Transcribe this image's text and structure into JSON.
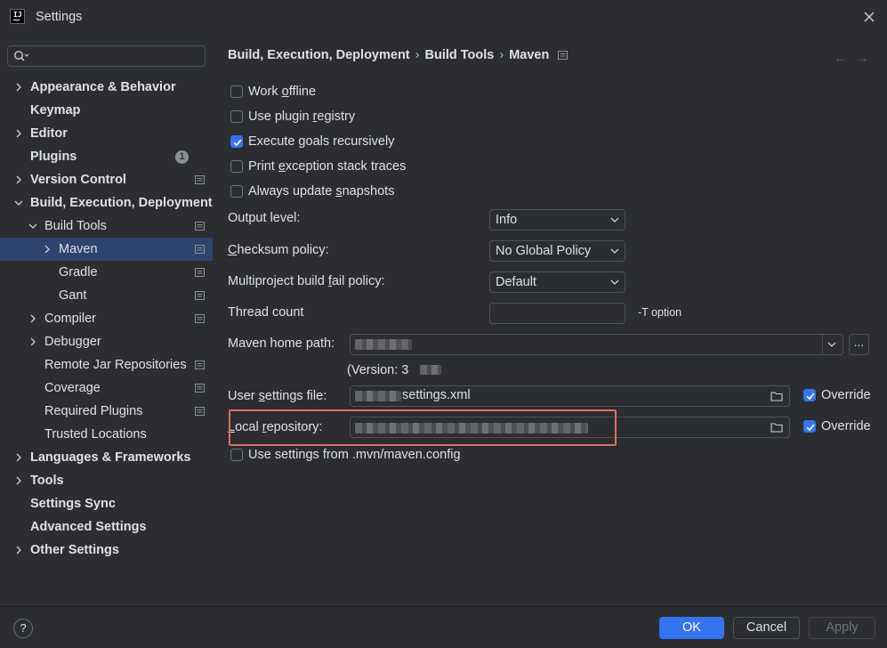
{
  "window": {
    "title": "Settings",
    "app_icon_text": "IJ"
  },
  "search": {
    "placeholder": "",
    "value": ""
  },
  "sidebar": {
    "items": [
      {
        "label": "Appearance & Behavior",
        "expandable": true,
        "expanded": false,
        "bold": true,
        "badge": "",
        "module": false
      },
      {
        "label": "Keymap",
        "expandable": false,
        "bold": true,
        "badge": "",
        "module": false
      },
      {
        "label": "Editor",
        "expandable": true,
        "expanded": false,
        "bold": true,
        "badge": "",
        "module": false
      },
      {
        "label": "Plugins",
        "expandable": false,
        "bold": true,
        "badge": "1",
        "module": false
      },
      {
        "label": "Version Control",
        "expandable": true,
        "expanded": false,
        "bold": true,
        "badge": "",
        "module": true
      },
      {
        "label": "Build, Execution, Deployment",
        "expandable": true,
        "expanded": true,
        "bold": true,
        "badge": "",
        "module": false
      },
      {
        "label": "Build Tools",
        "expandable": true,
        "expanded": true,
        "bold": false,
        "badge": "",
        "module": true
      },
      {
        "label": "Maven",
        "expandable": true,
        "expanded": false,
        "bold": false,
        "badge": "",
        "module": true,
        "selected": true
      },
      {
        "label": "Gradle",
        "expandable": false,
        "bold": false,
        "badge": "",
        "module": true
      },
      {
        "label": "Gant",
        "expandable": false,
        "bold": false,
        "badge": "",
        "module": true
      },
      {
        "label": "Compiler",
        "expandable": true,
        "expanded": false,
        "bold": false,
        "badge": "",
        "module": true
      },
      {
        "label": "Debugger",
        "expandable": true,
        "expanded": false,
        "bold": false,
        "badge": "",
        "module": false
      },
      {
        "label": "Remote Jar Repositories",
        "expandable": false,
        "bold": false,
        "badge": "",
        "module": true
      },
      {
        "label": "Coverage",
        "expandable": false,
        "bold": false,
        "badge": "",
        "module": true
      },
      {
        "label": "Required Plugins",
        "expandable": false,
        "bold": false,
        "badge": "",
        "module": true
      },
      {
        "label": "Trusted Locations",
        "expandable": false,
        "bold": false,
        "badge": "",
        "module": false
      },
      {
        "label": "Languages & Frameworks",
        "expandable": true,
        "expanded": false,
        "bold": true,
        "badge": "",
        "module": false
      },
      {
        "label": "Tools",
        "expandable": true,
        "expanded": false,
        "bold": true,
        "badge": "",
        "module": false
      },
      {
        "label": "Settings Sync",
        "expandable": false,
        "bold": true,
        "badge": "",
        "module": false
      },
      {
        "label": "Advanced Settings",
        "expandable": false,
        "bold": true,
        "badge": "",
        "module": false
      },
      {
        "label": "Other Settings",
        "expandable": true,
        "expanded": false,
        "bold": true,
        "badge": "",
        "module": false
      }
    ]
  },
  "breadcrumb": {
    "items": [
      "Build, Execution, Deployment",
      "Build Tools",
      "Maven"
    ],
    "separator": "›"
  },
  "checkboxes": {
    "work_offline": {
      "pre": "Work ",
      "ul": "o",
      "post": "ffline",
      "checked": false
    },
    "plugin_registry": {
      "pre": "Use plugin ",
      "ul": "r",
      "post": "egistry",
      "checked": false
    },
    "recursive": {
      "pre": "Execute ",
      "ul": "g",
      "post": "oals recursively",
      "checked": true
    },
    "stack_traces": {
      "pre": "Print ",
      "ul": "e",
      "post": "xception stack traces",
      "checked": false
    },
    "snapshots": {
      "pre": "Always update ",
      "ul": "s",
      "post": "napshots",
      "checked": false
    },
    "mvn_config": {
      "pre": "Use settings from .mvn/maven.config",
      "ul": "",
      "post": "",
      "checked": false
    }
  },
  "fields": {
    "output_level": {
      "label": "Output level:",
      "value": "Info"
    },
    "checksum_policy": {
      "label_ul": "C",
      "label_rest": "hecksum policy:",
      "value": "No Global Policy"
    },
    "fail_policy": {
      "label_pre": "Multiproject build ",
      "label_ul": "f",
      "label_post": "ail policy:",
      "value": "Default"
    },
    "thread_count": {
      "label": "Thread count",
      "value": "",
      "note": "-T option"
    },
    "maven_home": {
      "label": "Maven home path:",
      "version_label": "(Version: 3",
      "browse": "..."
    },
    "user_settings": {
      "label_pre": "User ",
      "label_ul": "s",
      "label_post": "ettings file:",
      "value_suffix": "settings.xml",
      "override_label": "Override",
      "override_checked": true
    },
    "local_repo": {
      "label_ul": "L",
      "label_mid": "ocal ",
      "label_ul2": "r",
      "label_post": "epository:",
      "override_label": "Override",
      "override_checked": true
    }
  },
  "footer": {
    "help": "?",
    "ok": "OK",
    "cancel": "Cancel",
    "apply": "Apply"
  },
  "colors": {
    "accent": "#3574f0",
    "background": "#2b2d30",
    "selection": "#2e436e",
    "highlight_box": "#e06c6c"
  }
}
